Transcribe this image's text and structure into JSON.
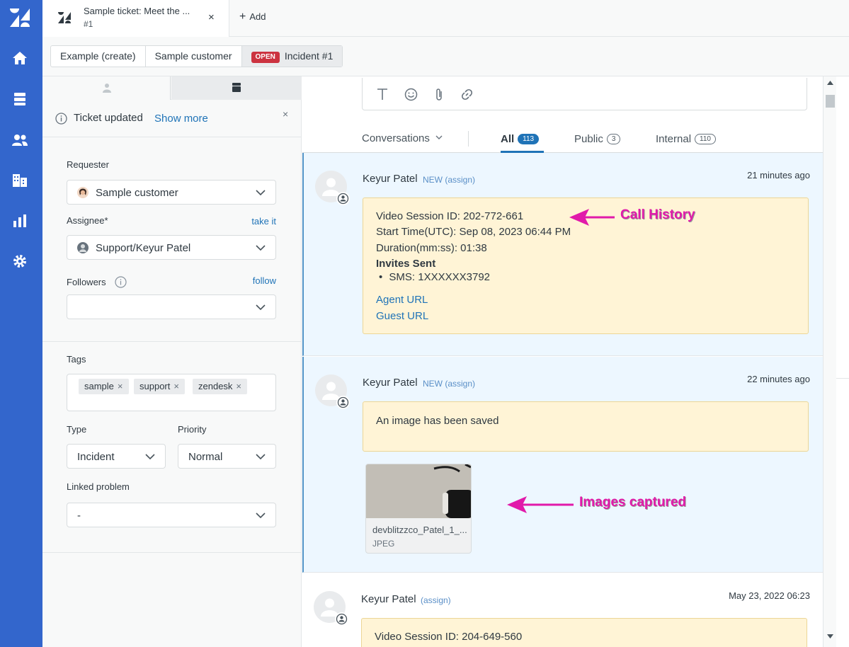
{
  "topbar": {
    "tab_title": "Sample ticket: Meet the ...",
    "tab_subtitle": "#1",
    "close_glyph": "×",
    "add_label": "Add"
  },
  "breadcrumbs": {
    "item1": "Example (create)",
    "item2": "Sample customer",
    "status_badge": "OPEN",
    "item3": "Incident #1"
  },
  "notice": {
    "text": "Ticket updated",
    "link": "Show more",
    "close": "×"
  },
  "fields": {
    "requester_label": "Requester",
    "requester_value": "Sample customer",
    "assignee_label": "Assignee*",
    "assignee_link": "take it",
    "assignee_value": "Support/Keyur Patel",
    "followers_label": "Followers",
    "followers_link": "follow",
    "tags_label": "Tags",
    "tags": [
      "sample",
      "support",
      "zendesk"
    ],
    "tag_remove": "×",
    "type_label": "Type",
    "type_value": "Incident",
    "priority_label": "Priority",
    "priority_value": "Normal",
    "linked_label": "Linked problem",
    "linked_value": "-"
  },
  "conversation_tabs": {
    "filter": "Conversations",
    "all_label": "All",
    "all_count": "113",
    "public_label": "Public",
    "public_count": "3",
    "internal_label": "Internal",
    "internal_count": "110"
  },
  "events": [
    {
      "author": "Keyur Patel",
      "tag": "NEW",
      "assign": "(assign)",
      "time": "21 minutes ago",
      "lines": [
        "Video Session ID: 202-772-661",
        "Start Time(UTC): Sep 08, 2023 06:44 PM",
        "Duration(mm:ss): 01:38"
      ],
      "invites_heading": "Invites Sent",
      "invite_item": "SMS: 1XXXXXX3792",
      "agent_url": "Agent URL",
      "guest_url": "Guest URL"
    },
    {
      "author": "Keyur Patel",
      "tag": "NEW",
      "assign": "(assign)",
      "time": "22 minutes ago",
      "message": "An image has been saved",
      "attachment_name": "devblitzzco_Patel_1_...",
      "attachment_type": "JPEG"
    },
    {
      "author": "Keyur Patel",
      "assign": "(assign)",
      "time": "May 23, 2022 06:23",
      "message": "Video Session ID: 204-649-560"
    }
  ],
  "annotations": {
    "call_history": "Call History",
    "images_captured": "Images captured"
  },
  "colors": {
    "nav_blue": "#3366cc",
    "link_blue": "#1f73b7",
    "open_red": "#cc3340",
    "note_yellow": "#fff4d6",
    "annotation_magenta": "#e11aaa"
  }
}
